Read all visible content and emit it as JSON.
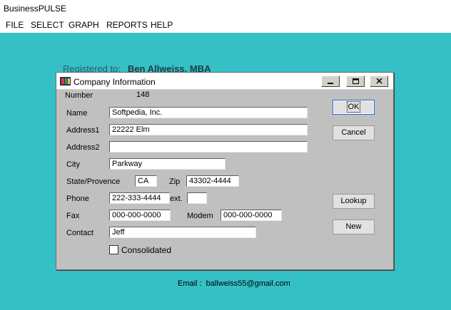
{
  "app": {
    "title": "BusinessPULSE"
  },
  "menu": {
    "items": [
      "FILE",
      "SELECT",
      "GRAPH",
      "REPORTS",
      "HELP"
    ]
  },
  "registration": {
    "label": "Registered to:",
    "name": "Ben Allweiss, MBA"
  },
  "dialog": {
    "title": "Company Information",
    "fields": {
      "number": {
        "label": "Number",
        "value": "148"
      },
      "name": {
        "label": "Name",
        "value": "Softpedia, Inc."
      },
      "address1": {
        "label": "Address1",
        "value": "22222 Elm"
      },
      "address2": {
        "label": "Address2",
        "value": ""
      },
      "city": {
        "label": "City",
        "value": "Parkway"
      },
      "state": {
        "label": "State/Provence",
        "value": "CA"
      },
      "zip": {
        "label": "Zip",
        "value": "43302-4444"
      },
      "phone": {
        "label": "Phone",
        "value": "222-333-4444"
      },
      "ext": {
        "label": "ext.",
        "value": ""
      },
      "fax": {
        "label": "Fax",
        "value": "000-000-0000"
      },
      "modem": {
        "label": "Modem",
        "value": "000-000-0000"
      },
      "contact": {
        "label": "Contact",
        "value": "Jeff"
      },
      "consolidated": {
        "label": "Consolidated",
        "checked": false
      }
    },
    "buttons": {
      "ok": "OK",
      "cancel": "Cancel",
      "lookup": "Lookup",
      "new": "New"
    }
  },
  "footer": {
    "email_label": "Email :",
    "email_value": "ballweiss55@gmail.com"
  },
  "colors": {
    "desktop": "#35c0c6",
    "dialog": "#c0c0c0"
  },
  "icons": {
    "dialog": "film-strip-icon",
    "minimize": "minimize-icon",
    "restore": "restore-icon",
    "close": "close-icon"
  }
}
